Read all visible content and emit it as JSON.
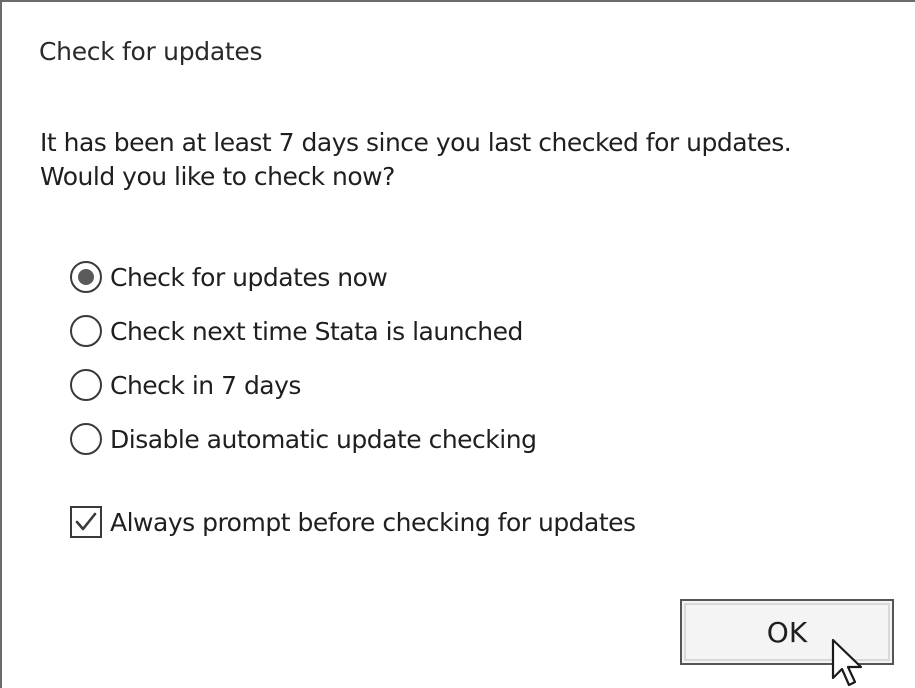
{
  "dialog": {
    "title": "Check for updates",
    "message_line1": "It has been at least 7 days since you last checked for updates.",
    "message_line2": "Would you like to check now?",
    "options": [
      {
        "label": "Check for updates now",
        "selected": true
      },
      {
        "label": "Check next time Stata is launched",
        "selected": false
      },
      {
        "label": "Check in 7 days",
        "selected": false
      },
      {
        "label": "Disable automatic update checking",
        "selected": false
      }
    ],
    "always_prompt": {
      "label": "Always prompt before checking for updates",
      "checked": true
    },
    "ok_label": "OK"
  },
  "icons": {
    "checkbox": "checkmark-icon",
    "cursor": "mouse-pointer-icon"
  }
}
